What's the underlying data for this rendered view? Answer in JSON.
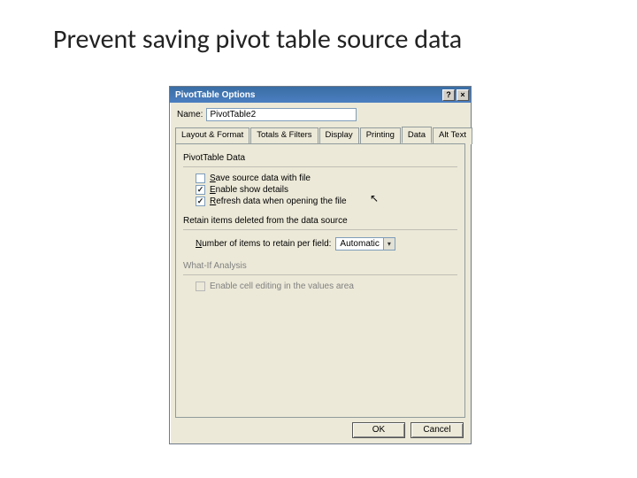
{
  "slide": {
    "title": "Prevent saving pivot table source data"
  },
  "dialog": {
    "title": "PivotTable Options",
    "help_btn": "?",
    "close_btn": "×",
    "name_label": "Name:",
    "name_value": "PivotTable2",
    "tabs": [
      "Layout & Format",
      "Totals & Filters",
      "Display",
      "Printing",
      "Data",
      "Alt Text"
    ],
    "active_tab": "Data",
    "panel": {
      "sec1_title": "PivotTable Data",
      "chk_save": "Save source data with file",
      "chk_save_u": "S",
      "chk_show": "Enable show details",
      "chk_show_u": "E",
      "chk_refresh": "Refresh data when opening the file",
      "chk_refresh_u": "R",
      "sec2_title": "Retain items deleted from the data source",
      "retain_label": "Number of items to retain per field:",
      "retain_u": "N",
      "retain_value": "Automatic",
      "sec3_title": "What-If Analysis",
      "chk_whatif": "Enable cell editing in the values area"
    },
    "buttons": {
      "ok": "OK",
      "cancel": "Cancel"
    }
  }
}
